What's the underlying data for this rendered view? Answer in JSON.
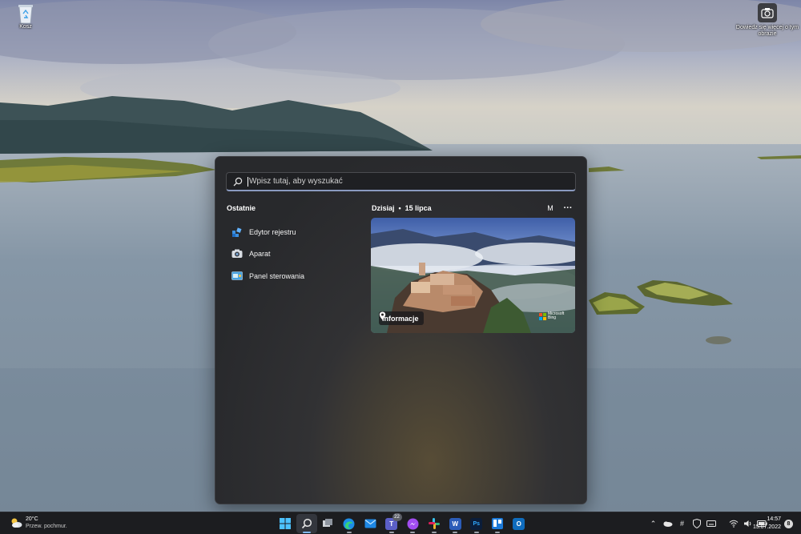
{
  "desktop": {
    "recycle_bin_label": "Kosz",
    "spotlight_label": "Dowiedz się więcej o tym obrazie"
  },
  "search": {
    "placeholder": "Wpisz tutaj, aby wyszukać"
  },
  "recent": {
    "title": "Ostatnie",
    "items": [
      {
        "label": "Edytor rejestru",
        "icon": "registry-editor-icon"
      },
      {
        "label": "Aparat",
        "icon": "camera-icon"
      },
      {
        "label": "Panel sterowania",
        "icon": "control-panel-icon"
      }
    ]
  },
  "today": {
    "label": "Dzisiaj",
    "date": "15 lipca",
    "profile_initial": "M",
    "more": "···",
    "card": {
      "info_label": "Informacje",
      "brand_line1": "Microsoft",
      "brand_line2": "Bing"
    }
  },
  "taskbar": {
    "weather": {
      "temp": "20°C",
      "condition": "Przew. pochmur."
    },
    "apps": [
      {
        "name": "start",
        "icon": "windows-start-icon",
        "active": false
      },
      {
        "name": "search",
        "icon": "search-icon",
        "active": true
      },
      {
        "name": "task-view",
        "icon": "task-view-icon",
        "active": false
      },
      {
        "name": "edge",
        "icon": "edge-icon",
        "active": false
      },
      {
        "name": "mail",
        "icon": "mail-icon",
        "active": false
      },
      {
        "name": "teams",
        "icon": "teams-icon",
        "active": false,
        "badge": "22"
      },
      {
        "name": "messenger",
        "icon": "messenger-icon",
        "active": false
      },
      {
        "name": "slack",
        "icon": "slack-icon",
        "active": false
      },
      {
        "name": "word",
        "icon": "word-icon",
        "active": false
      },
      {
        "name": "photoshop",
        "icon": "photoshop-icon",
        "active": false
      },
      {
        "name": "trello",
        "icon": "trello-icon",
        "active": false
      },
      {
        "name": "outlook",
        "icon": "outlook-icon",
        "active": false
      }
    ],
    "tray": {
      "time": "14:57",
      "date": "15.07.2022",
      "notification_count": "8"
    }
  },
  "colors": {
    "accent": "#7fb8f0",
    "flyout_bg": "#2a2b2e",
    "taskbar_bg": "#1c1d20"
  }
}
